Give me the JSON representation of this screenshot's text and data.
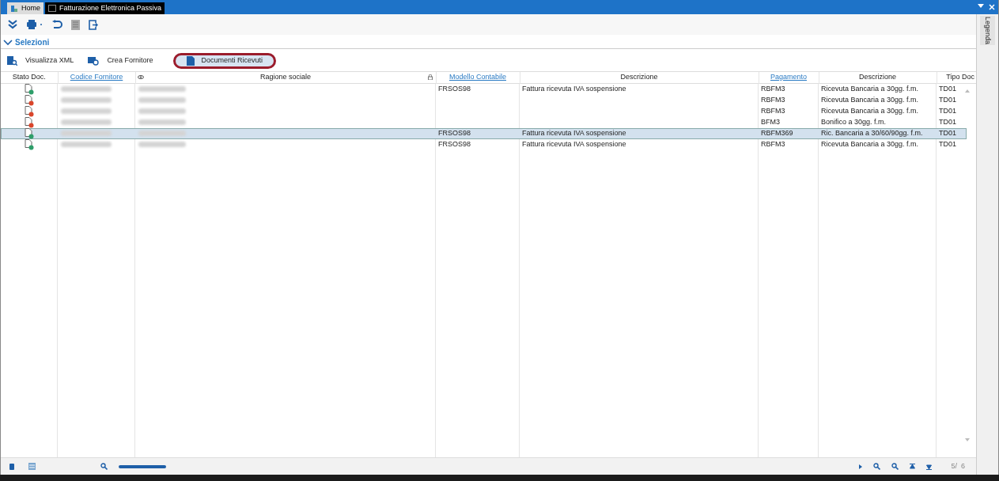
{
  "window": {
    "tabs": [
      {
        "label": "Home",
        "selected": false
      },
      {
        "label": "Fatturazione Elettronica Passiva",
        "selected": true
      }
    ]
  },
  "section": {
    "title": "Selezioni",
    "expanded": true
  },
  "actions": [
    {
      "label": "Visualizza XML",
      "highlighted": false
    },
    {
      "label": "Crea Fornitore",
      "highlighted": false
    },
    {
      "label": "Documenti Ricevuti",
      "highlighted": true
    }
  ],
  "table": {
    "columns": [
      {
        "label": "Stato Doc.",
        "link": false
      },
      {
        "label": "Codice Fornitore",
        "link": true
      },
      {
        "label": "Ragione sociale",
        "link": false
      },
      {
        "label": "Modello Contabile",
        "link": true
      },
      {
        "label": "Descrizione",
        "link": false
      },
      {
        "label": "Pagamento",
        "link": true
      },
      {
        "label": "Descrizione",
        "link": false
      },
      {
        "label": "Tipo Doc",
        "link": false
      }
    ],
    "rows": [
      {
        "color": "#2e9e6a",
        "selected": false,
        "cells": [
          "",
          "",
          "",
          "FRSOS98",
          "Fattura ricevuta IVA sospensione",
          "RBFM3",
          "Ricevuta Bancaria a 30gg. f.m.",
          "TD01"
        ]
      },
      {
        "color": "#d9452b",
        "selected": false,
        "cells": [
          "",
          "",
          "",
          "",
          "",
          "RBFM3",
          "Ricevuta Bancaria a 30gg. f.m.",
          "TD01"
        ]
      },
      {
        "color": "#d9452b",
        "selected": false,
        "cells": [
          "",
          "",
          "",
          "",
          "",
          "RBFM3",
          "Ricevuta Bancaria a 30gg. f.m.",
          "TD01"
        ]
      },
      {
        "color": "#d9452b",
        "selected": false,
        "cells": [
          "",
          "",
          "",
          "",
          "",
          "BFM3",
          "Bonifico a 30gg. f.m.",
          "TD01"
        ]
      },
      {
        "color": "#2e9e6a",
        "selected": true,
        "cells": [
          "",
          "",
          "",
          "FRSOS98",
          "Fattura ricevuta IVA sospensione",
          "RBFM369",
          "Ric. Bancaria a 30/60/90gg. f.m.",
          "TD01"
        ]
      },
      {
        "color": "#2e9e6a",
        "selected": false,
        "cells": [
          "",
          "",
          "",
          "FRSOS98",
          "Fattura ricevuta IVA sospensione",
          "RBFM3",
          "Ricevuta Bancaria a 30gg. f.m.",
          "TD01"
        ]
      }
    ]
  },
  "side_tab": "Legenda",
  "pager": "5/  6"
}
